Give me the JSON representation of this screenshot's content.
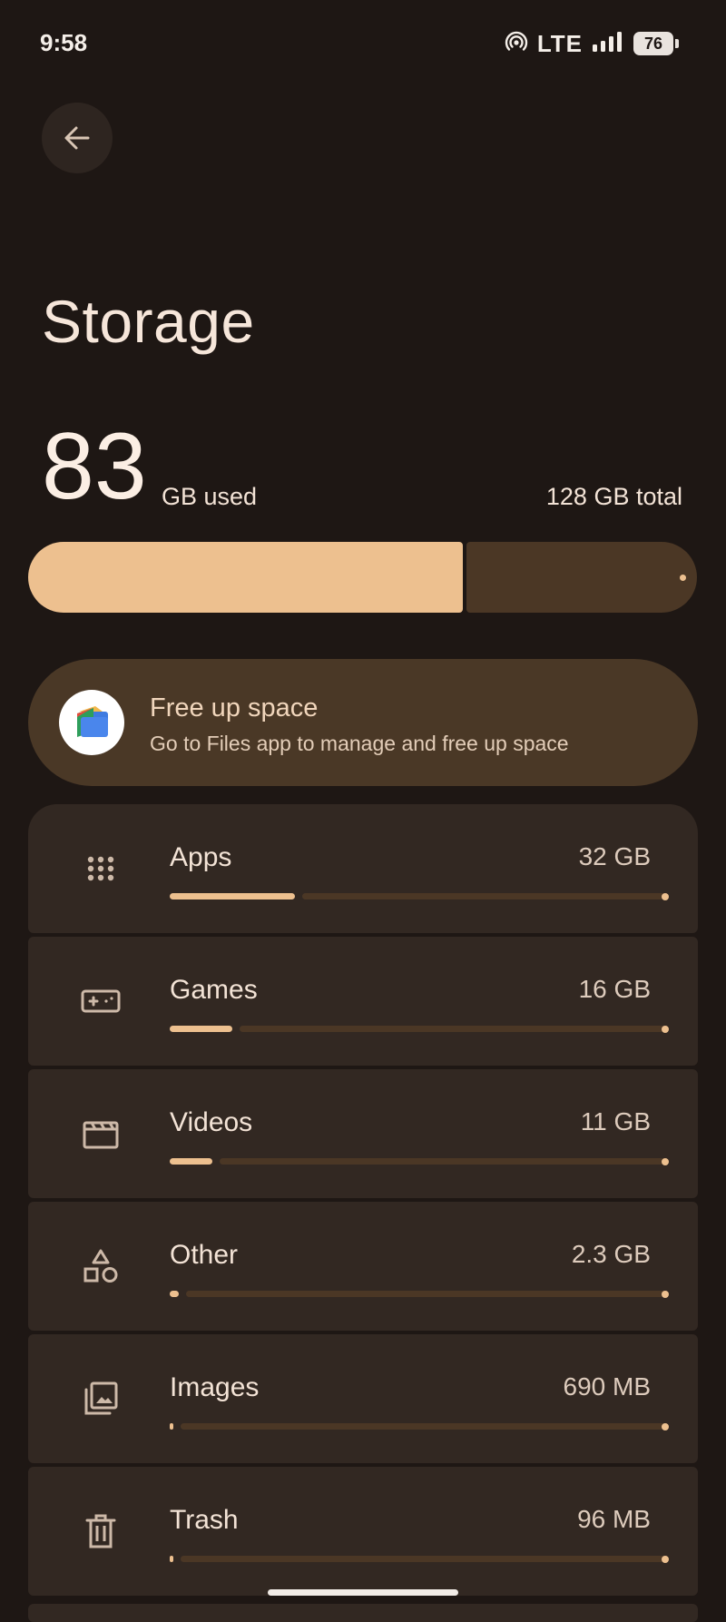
{
  "status_bar": {
    "time": "9:58",
    "network": "LTE",
    "battery": "76"
  },
  "header": {
    "back_icon": "arrow-left-icon",
    "title": "Storage"
  },
  "usage": {
    "used_value": "83",
    "used_label": "GB used",
    "total_label": "128 GB total",
    "used_fraction": 0.65
  },
  "free_up": {
    "icon": "files-app-icon",
    "title": "Free up space",
    "subtitle": "Go to Files app to manage and free up space"
  },
  "categories": [
    {
      "label": "Apps",
      "size": "32 GB",
      "icon": "apps-grid-icon",
      "fraction": 0.25
    },
    {
      "label": "Games",
      "size": "16 GB",
      "icon": "gamepad-icon",
      "fraction": 0.125
    },
    {
      "label": "Videos",
      "size": "11 GB",
      "icon": "movie-clapper-icon",
      "fraction": 0.086
    },
    {
      "label": "Other",
      "size": "2.3 GB",
      "icon": "shapes-icon",
      "fraction": 0.018
    },
    {
      "label": "Images",
      "size": "690 MB",
      "icon": "images-icon",
      "fraction": 0.005
    },
    {
      "label": "Trash",
      "size": "96 MB",
      "icon": "trash-icon",
      "fraction": 0.001
    }
  ],
  "colors": {
    "background": "#1e1714",
    "accent": "#edc08f",
    "track": "#4b3725",
    "card": "#322822"
  }
}
